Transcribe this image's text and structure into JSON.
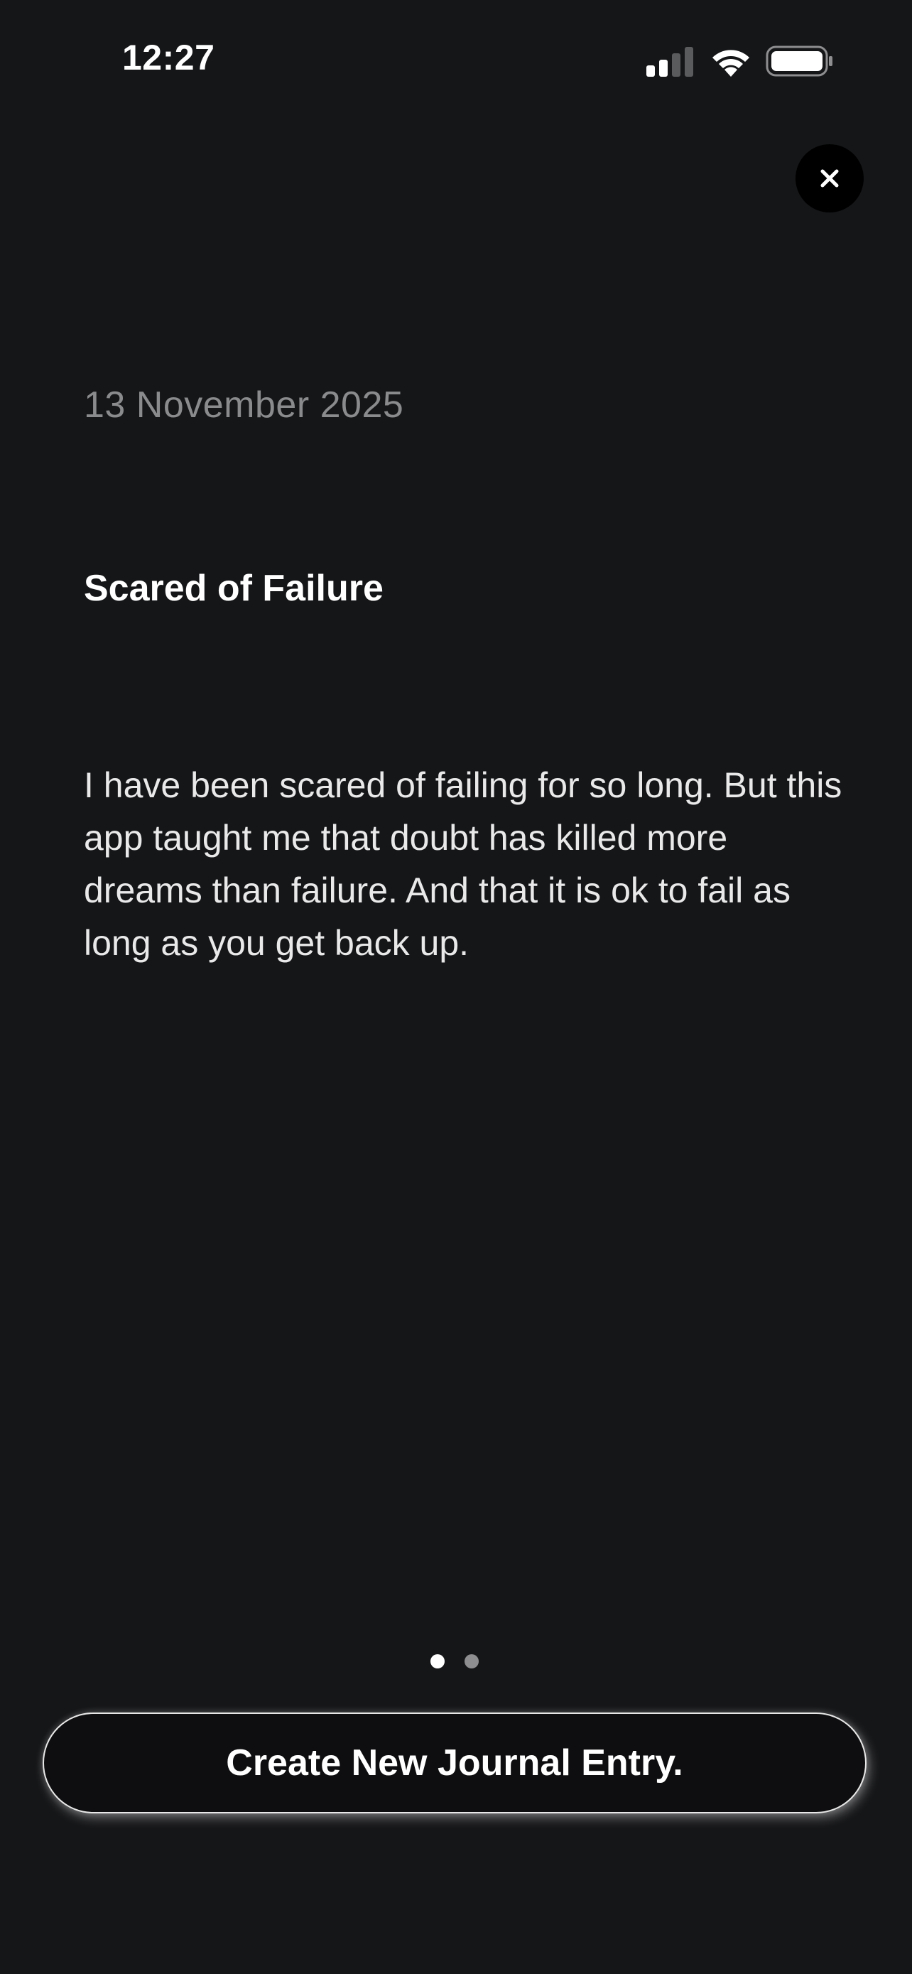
{
  "status_bar": {
    "time": "12:27",
    "icons": [
      "signal-icon",
      "wifi-icon",
      "battery-icon"
    ]
  },
  "header": {
    "close_icon": "close-icon"
  },
  "entry": {
    "date": "13 November 2025",
    "title": "Scared of Failure",
    "body": "I have been scared of failing for so long. But this app taught me that doubt has killed more dreams than failure. And that it is ok to fail as long as you get back up."
  },
  "pager": {
    "total": 2,
    "current": 1
  },
  "cta": {
    "label": "Create New Journal Entry."
  },
  "colors": {
    "background": "#151618",
    "text": "#ffffff",
    "date": "#8a8b8d",
    "button_bg": "#0e0e10"
  }
}
